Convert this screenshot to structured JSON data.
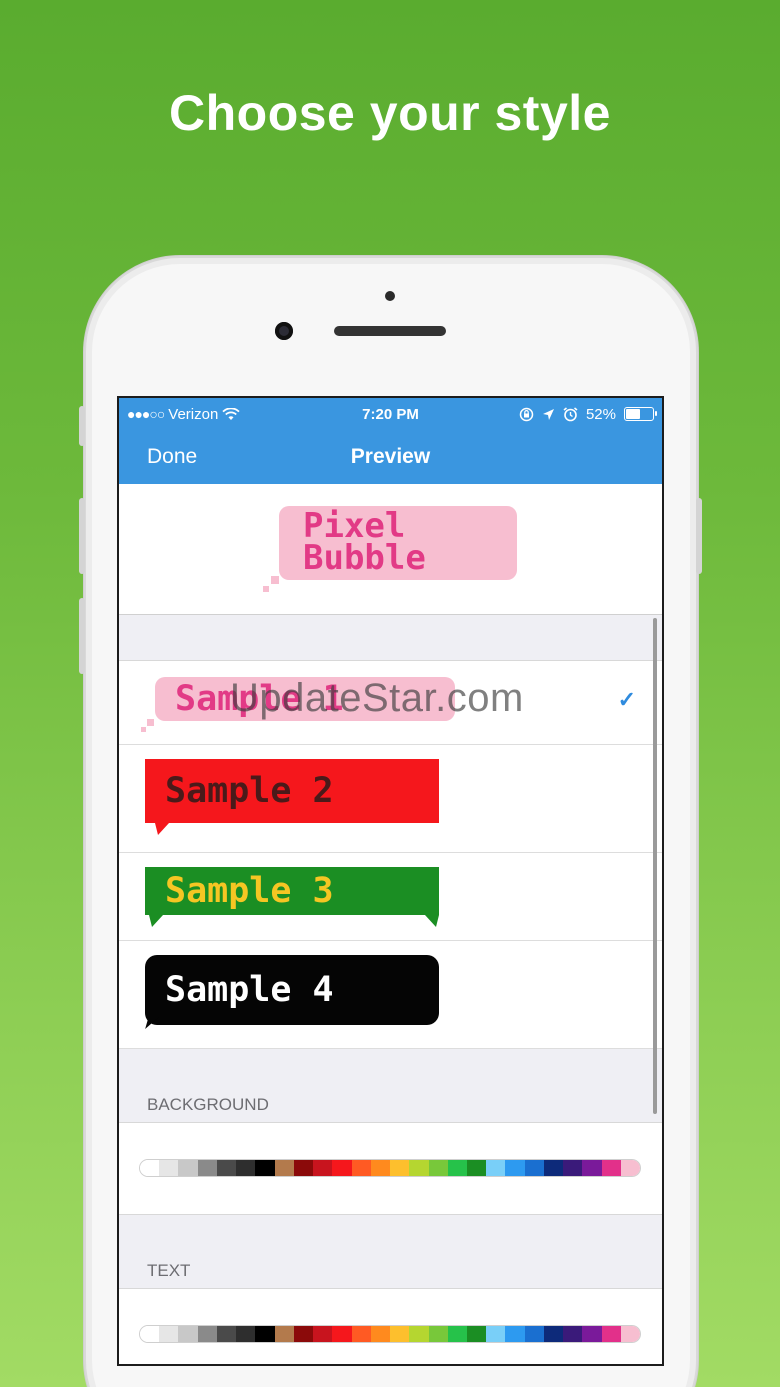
{
  "headline": "Choose your style",
  "status": {
    "carrier": "Verizon",
    "signal_dots": "●●●○○",
    "time": "7:20 PM",
    "battery": "52%",
    "battery_level": 0.52
  },
  "nav": {
    "done_label": "Done",
    "title": "Preview"
  },
  "preview": {
    "line1": "Pixel",
    "line2": "Bubble"
  },
  "styles": [
    {
      "label": "Sample 1",
      "selected": true
    },
    {
      "label": "Sample 2",
      "selected": false
    },
    {
      "label": "Sample 3",
      "selected": false
    },
    {
      "label": "Sample 4",
      "selected": false
    }
  ],
  "check_glyph": "✓",
  "watermark": "UpdateStar.com",
  "sections": {
    "background": "BACKGROUND",
    "text": "TEXT"
  },
  "palette_colors": [
    "#ffffff",
    "#e6e6e6",
    "#c8c8c8",
    "#8a8a8a",
    "#4a4a4a",
    "#2e2e2e",
    "#000000",
    "#b37a4c",
    "#8b0a0a",
    "#c8141e",
    "#f5171c",
    "#ff5a23",
    "#ff8a1e",
    "#fdbf2d",
    "#b5d630",
    "#78c83a",
    "#26c24a",
    "#1b8e23",
    "#79cff8",
    "#2d9af0",
    "#1a6fd0",
    "#0d2a7a",
    "#3a1a7a",
    "#7a1a9a",
    "#e2308a",
    "#f7bed0"
  ]
}
